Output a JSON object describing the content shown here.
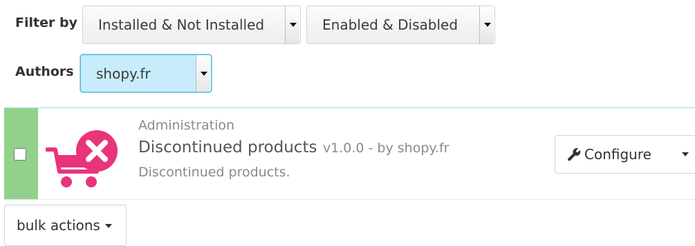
{
  "filters": {
    "filter_by_label": "Filter by",
    "install_select": {
      "value": "Installed & Not Installed"
    },
    "status_select": {
      "value": "Enabled & Disabled"
    },
    "authors_label": "Authors",
    "authors_select": {
      "value": "shopy.fr"
    }
  },
  "module": {
    "category": "Administration",
    "name": "Discontinued products",
    "version_author": "v1.0.0 - by shopy.fr",
    "description": "Discontinued products.",
    "checked": false,
    "logo_icon": "cart-remove-icon",
    "logo_color": "#e8347a",
    "status_color": "#92d18b",
    "configure_label": "Configure"
  },
  "bulk": {
    "label": "bulk actions"
  }
}
